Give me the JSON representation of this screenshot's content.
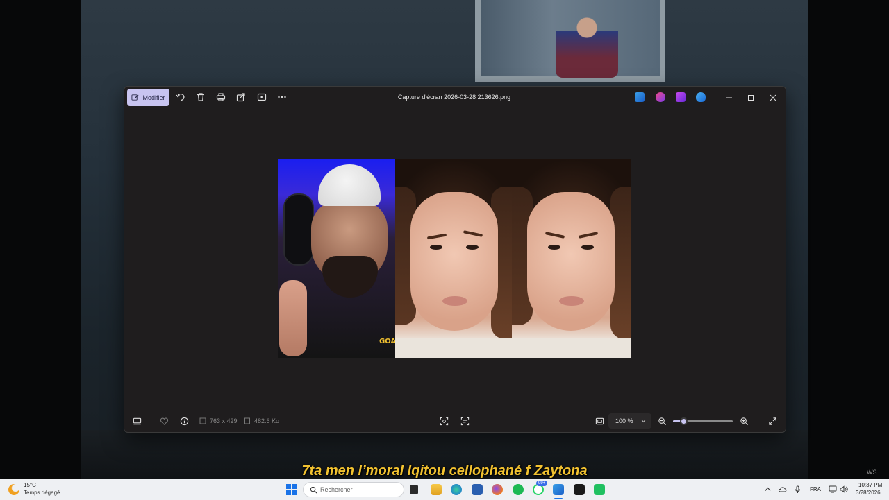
{
  "window": {
    "title": "Capture d'écran 2026-03-28 213626.png",
    "edit_label": "Modifier"
  },
  "photo": {
    "overlay_text": "GOAT"
  },
  "info": {
    "dimensions": "763 x 429",
    "file_size": "482.6 Ko",
    "zoom": "100 %",
    "zoom_fraction": 0.18
  },
  "subtitle": "7ta men l’moral lqitou cellophané f Zaytona",
  "watermark": "WS",
  "taskbar": {
    "weather_temp": "15°C",
    "weather_condition": "Temps dégagé",
    "search_placeholder": "Rechercher",
    "notification_badge": "99+",
    "language": "FRA",
    "time": "10:37 PM",
    "date": "3/28/2026"
  },
  "colors": {
    "accent": "#c8c4f0",
    "app_background": "#1f1d1e",
    "subtitle": "#f2c230",
    "taskbar": "#eef0f3"
  }
}
